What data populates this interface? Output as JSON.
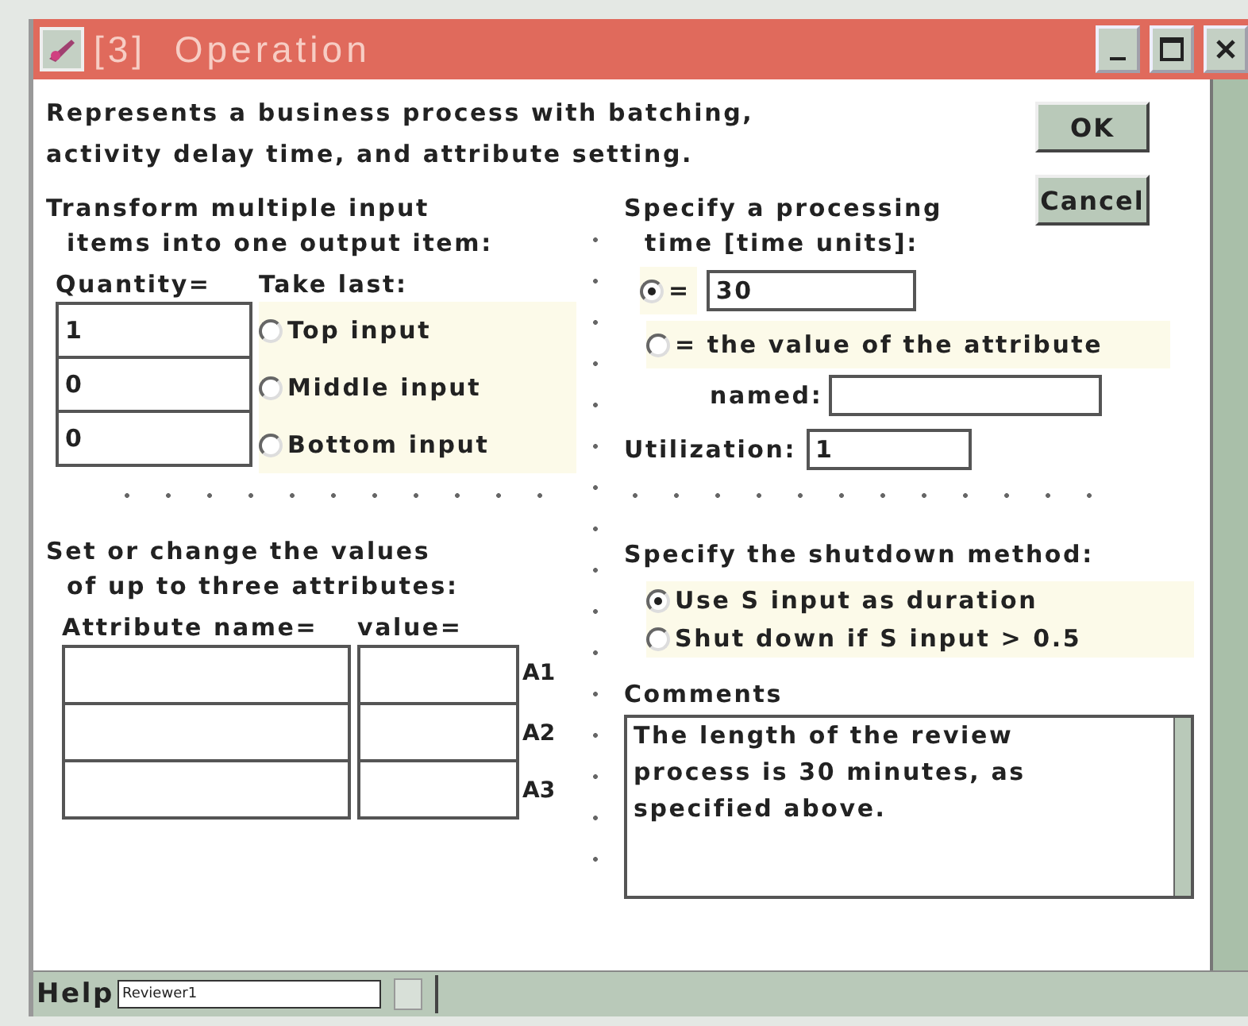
{
  "window": {
    "title": "[3]  Operation"
  },
  "description": "Represents a business process with batching,\nactivity delay time, and attribute setting.",
  "buttons": [
    {
      "label": "OK"
    },
    {
      "label": "Cancel"
    }
  ],
  "batching": {
    "heading": "Transform multiple input\n  items into one output item:",
    "quantity_label": "Quantity=",
    "take_last_label": "Take last:",
    "rows": [
      {
        "quantity": "1",
        "option": "Top input",
        "selected": false
      },
      {
        "quantity": "0",
        "option": "Middle input",
        "selected": false
      },
      {
        "quantity": "0",
        "option": "Bottom input",
        "selected": false
      }
    ]
  },
  "processing": {
    "heading": "Specify a processing\n  time [time units]:",
    "options": [
      {
        "kind": "value",
        "label": "=",
        "value": "30",
        "selected": true
      },
      {
        "kind": "attribute",
        "label": "= the value of the attribute",
        "named_label": "named:",
        "selected": false
      }
    ],
    "utilization_label": "Utilization:",
    "utilization": "1"
  },
  "attributes": {
    "heading": "Set or change the values\n  of up to three attributes:",
    "name_label": "Attribute name=",
    "value_label": "value=",
    "rows": [
      {
        "tag": "A1"
      },
      {
        "tag": "A2"
      },
      {
        "tag": "A3"
      }
    ]
  },
  "shutdown": {
    "heading": "Specify the shutdown method:",
    "options": [
      {
        "label": "Use S input as duration",
        "selected": true
      },
      {
        "label": "Shut down if S input > 0.5",
        "selected": false
      }
    ]
  },
  "comments": {
    "label": "Comments",
    "text": "The length of the review\nprocess is 30 minutes, as\nspecified above."
  },
  "status_bar": {
    "help": "Help",
    "field": "Reviewer1"
  }
}
